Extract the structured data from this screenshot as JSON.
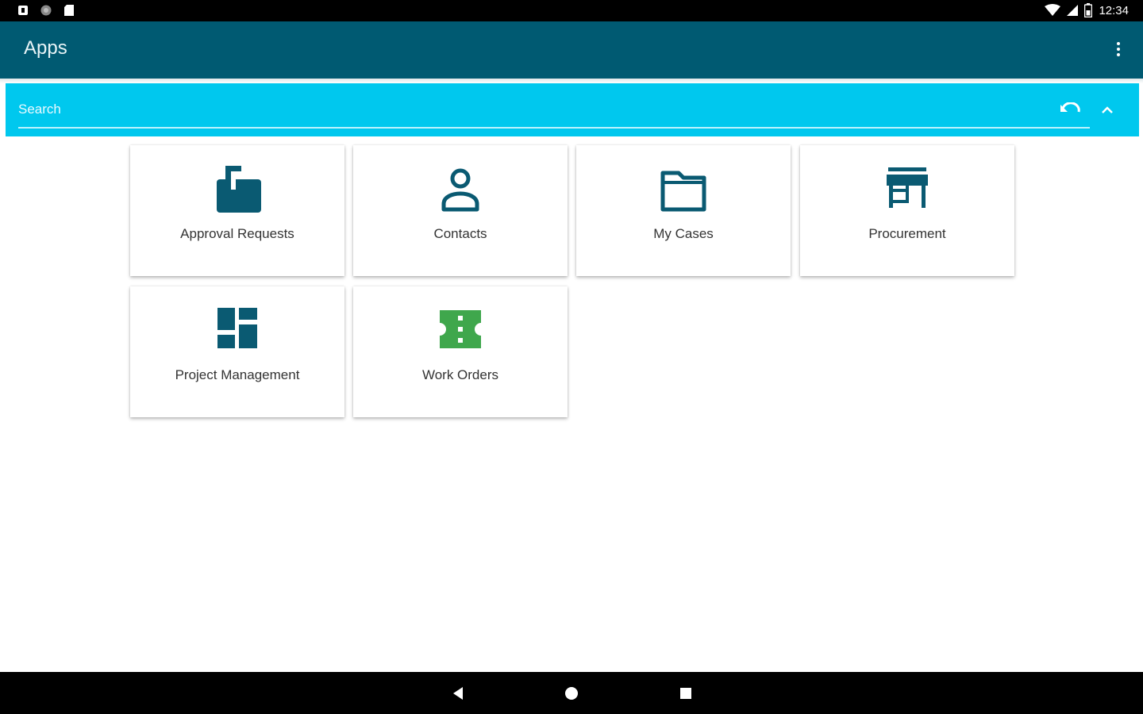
{
  "status_bar": {
    "time": "12:34",
    "icons": [
      "notification-icon",
      "sync-icon",
      "sd-card-icon",
      "wifi-icon",
      "signal-icon",
      "battery-icon"
    ]
  },
  "app_bar": {
    "title": "Apps",
    "menu_icon": "more-vert-icon"
  },
  "search": {
    "placeholder": "Search",
    "value": "",
    "undo_icon": "undo-icon",
    "collapse_icon": "chevron-up-icon"
  },
  "tiles": [
    {
      "label": "Approval Requests",
      "icon": "mailbox-icon",
      "color": "#0a5a72"
    },
    {
      "label": "Contacts",
      "icon": "person-icon",
      "color": "#0a5a72"
    },
    {
      "label": "My Cases",
      "icon": "folder-icon",
      "color": "#0a5a72"
    },
    {
      "label": "Procurement",
      "icon": "store-icon",
      "color": "#0a5a72"
    },
    {
      "label": "Project Management",
      "icon": "dashboard-icon",
      "color": "#0a5a72"
    },
    {
      "label": "Work Orders",
      "icon": "ticket-icon",
      "color": "#3fa74c"
    }
  ],
  "colors": {
    "app_bar": "#005a72",
    "search_bar": "#00c8ee",
    "icon_primary": "#0a5a72",
    "icon_accent": "#3fa74c"
  },
  "nav_bar": {
    "buttons": [
      "back-icon",
      "home-icon",
      "recents-icon"
    ]
  }
}
